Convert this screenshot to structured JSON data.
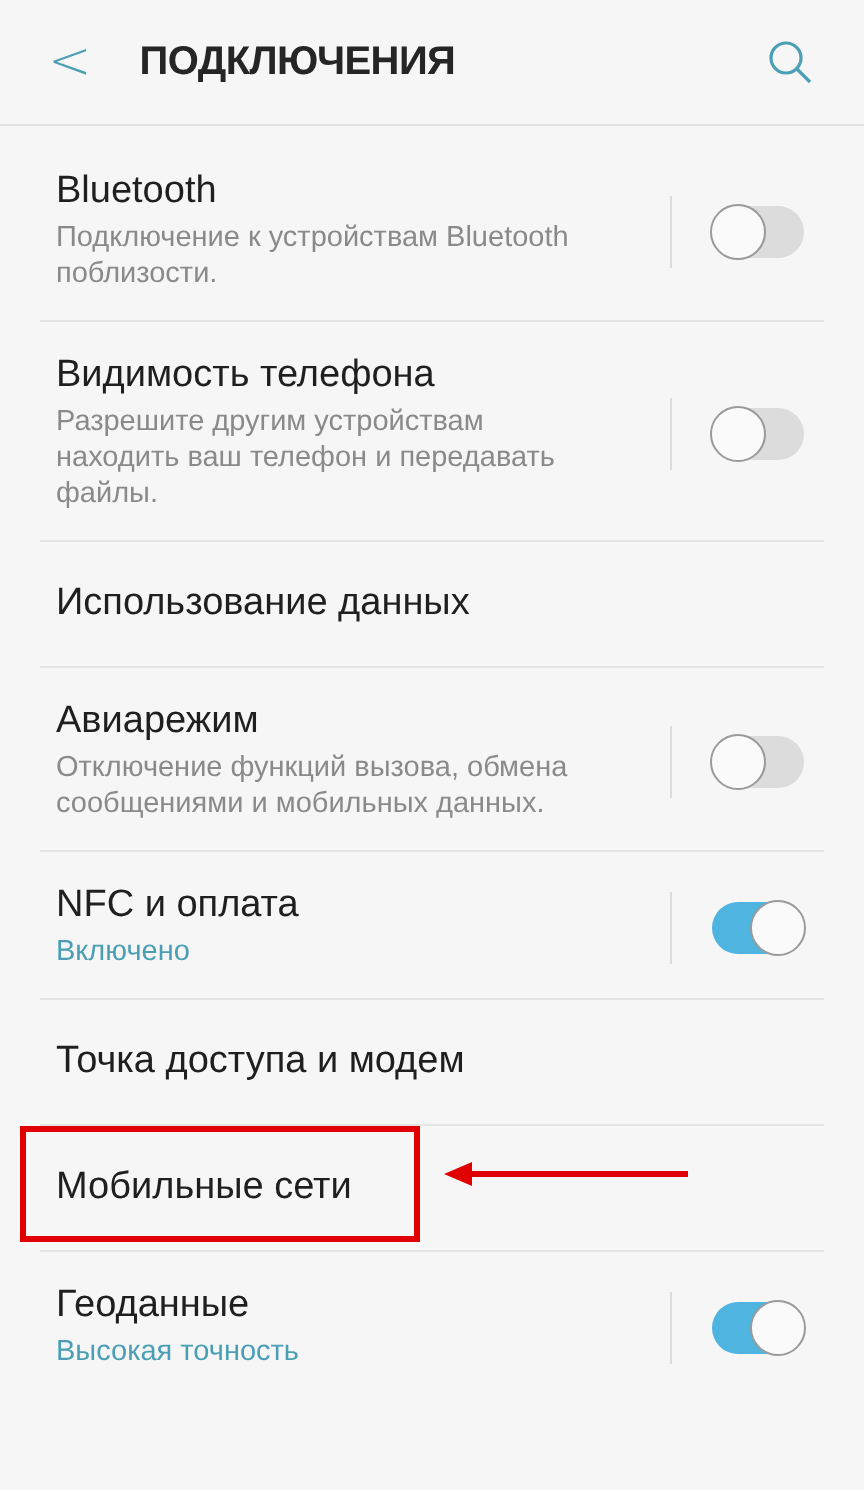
{
  "header": {
    "back": "<",
    "title": "ПОДКЛЮЧЕНИЯ"
  },
  "items": [
    {
      "kind": "toggle",
      "title": "Bluetooth",
      "subtitle": {
        "kind": "description",
        "text": "Подключение к устройствам Bluetooth поблизости."
      },
      "on": false,
      "annotated": false
    },
    {
      "kind": "toggle",
      "title": "Видимость телефона",
      "subtitle": {
        "kind": "description",
        "text": "Разрешите другим устройствам находить ваш телефон и передавать файлы."
      },
      "on": false,
      "annotated": false
    },
    {
      "kind": "plain",
      "title": "Использование данных",
      "annotated": false
    },
    {
      "kind": "toggle",
      "title": "Авиарежим",
      "subtitle": {
        "kind": "description",
        "text": "Отключение функций вызова, обмена сообщениями и мобильных данных."
      },
      "on": false,
      "annotated": false
    },
    {
      "kind": "toggle",
      "title": "NFC и оплата",
      "subtitle": {
        "kind": "status",
        "text": "Включено"
      },
      "on": true,
      "annotated": false
    },
    {
      "kind": "plain",
      "title": "Точка доступа и модем",
      "annotated": false
    },
    {
      "kind": "plain",
      "title": "Мобильные сети",
      "annotated": true
    },
    {
      "kind": "toggle",
      "title": "Геоданные",
      "subtitle": {
        "kind": "status",
        "text": "Высокая точность"
      },
      "on": true,
      "annotated": false
    }
  ]
}
